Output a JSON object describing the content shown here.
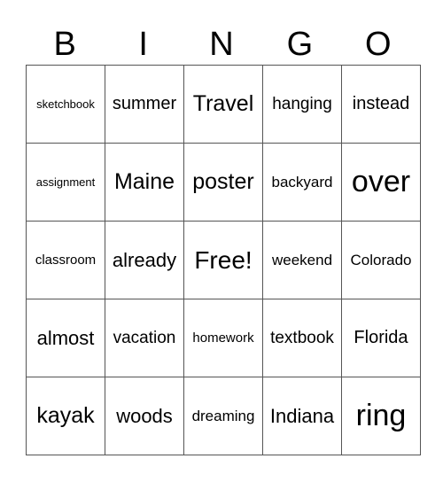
{
  "header": [
    "B",
    "I",
    "N",
    "G",
    "O"
  ],
  "rows": [
    [
      "sketchbook",
      "summer",
      "Travel",
      "hanging",
      "instead"
    ],
    [
      "assignment",
      "Maine",
      "poster",
      "backyard",
      "over"
    ],
    [
      "classroom",
      "already",
      "Free!",
      "weekend",
      "Colorado"
    ],
    [
      "almost",
      "vacation",
      "homework",
      "textbook",
      "Florida"
    ],
    [
      "kayak",
      "woods",
      "dreaming",
      "Indiana",
      "ring"
    ]
  ]
}
